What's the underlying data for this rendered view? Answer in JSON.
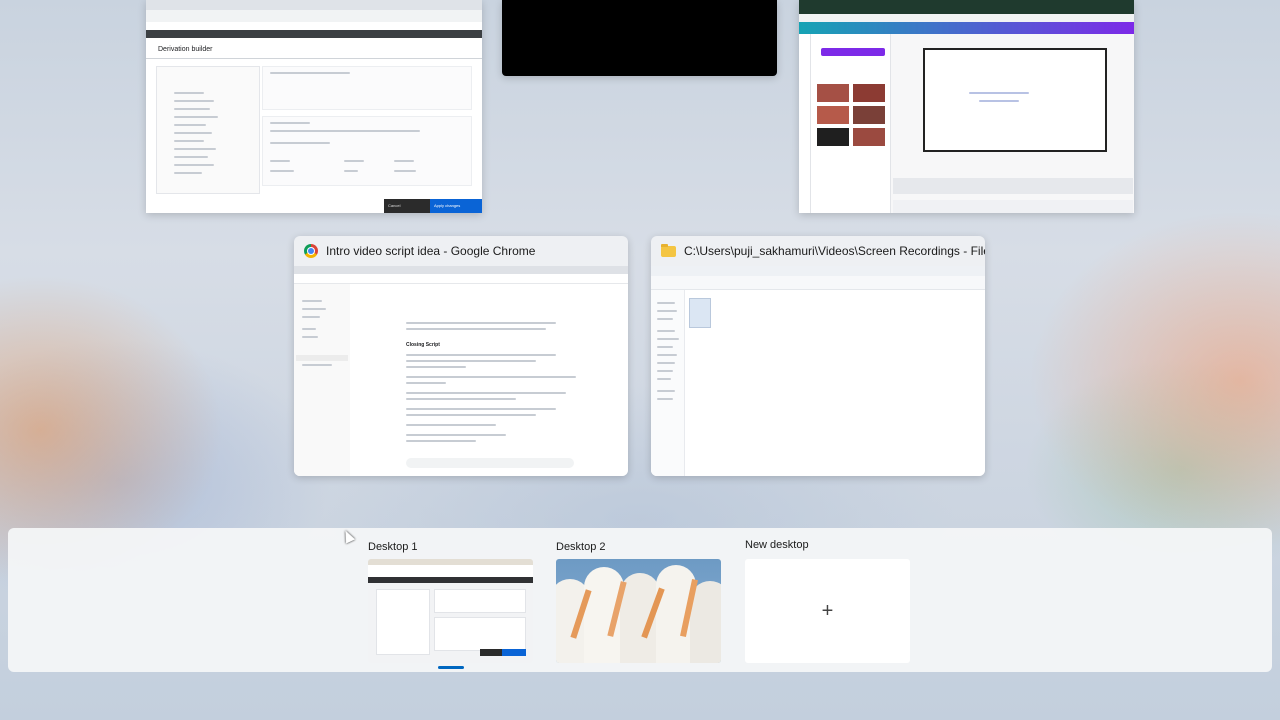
{
  "windows": [
    {
      "title": "",
      "content_heading": "Derivation builder",
      "buttons": [
        "Cancel",
        "Apply changes"
      ]
    },
    {
      "title": ""
    },
    {
      "title": ""
    },
    {
      "title": "Intro video script idea - Google Chrome",
      "icon": "chrome-icon",
      "content_heading": "Closing Script"
    },
    {
      "title": "C:\\Users\\puji_sakhamuri\\Videos\\Screen Recordings - File Explorer",
      "icon": "folder-icon"
    }
  ],
  "desktops": [
    {
      "label": "Desktop 1",
      "active": true
    },
    {
      "label": "Desktop 2",
      "active": false
    },
    {
      "label": "New desktop",
      "icon": "plus-icon"
    }
  ],
  "colors": {
    "accent": "#0a64d6",
    "active_indicator": "#0067c0",
    "canva_purple": "#7d2ae8",
    "dark_bg": "#000000"
  }
}
